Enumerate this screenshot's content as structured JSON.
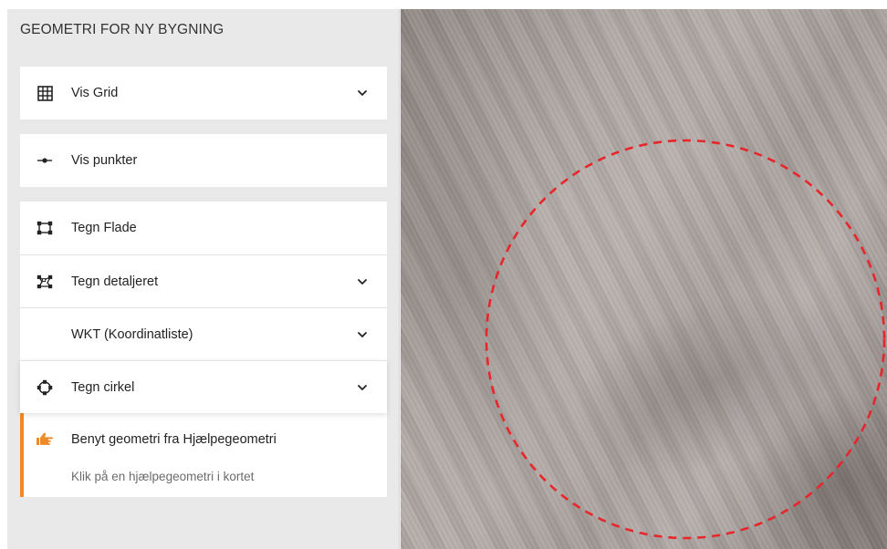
{
  "panel": {
    "title": "GEOMETRI FOR NY BYGNING"
  },
  "items": {
    "vis_grid": {
      "label": "Vis Grid",
      "icon": "grid-icon",
      "expandable": true
    },
    "vis_punkter": {
      "label": "Vis punkter",
      "icon": "points-line-icon",
      "expandable": false
    },
    "tegn_flade": {
      "label": "Tegn Flade",
      "icon": "draw-polygon-icon",
      "expandable": false
    },
    "tegn_detaljeret": {
      "label": "Tegn detaljeret",
      "icon": "draw-detailed-icon",
      "expandable": true
    },
    "wkt": {
      "label": "WKT (Koordinatliste)",
      "icon": null,
      "expandable": true
    },
    "tegn_cirkel": {
      "label": "Tegn cirkel",
      "icon": "draw-circle-icon",
      "expandable": true
    }
  },
  "hint": {
    "title": "Benyt geometri fra Hjælpegeometri",
    "subtitle": "Klik på en hjælpegeometri i kortet",
    "icon": "pointing-hand-icon",
    "accent_color": "#f08a24"
  },
  "map": {
    "drawn_shape": "dashed-circle",
    "stroke_color": "#e8262a"
  }
}
